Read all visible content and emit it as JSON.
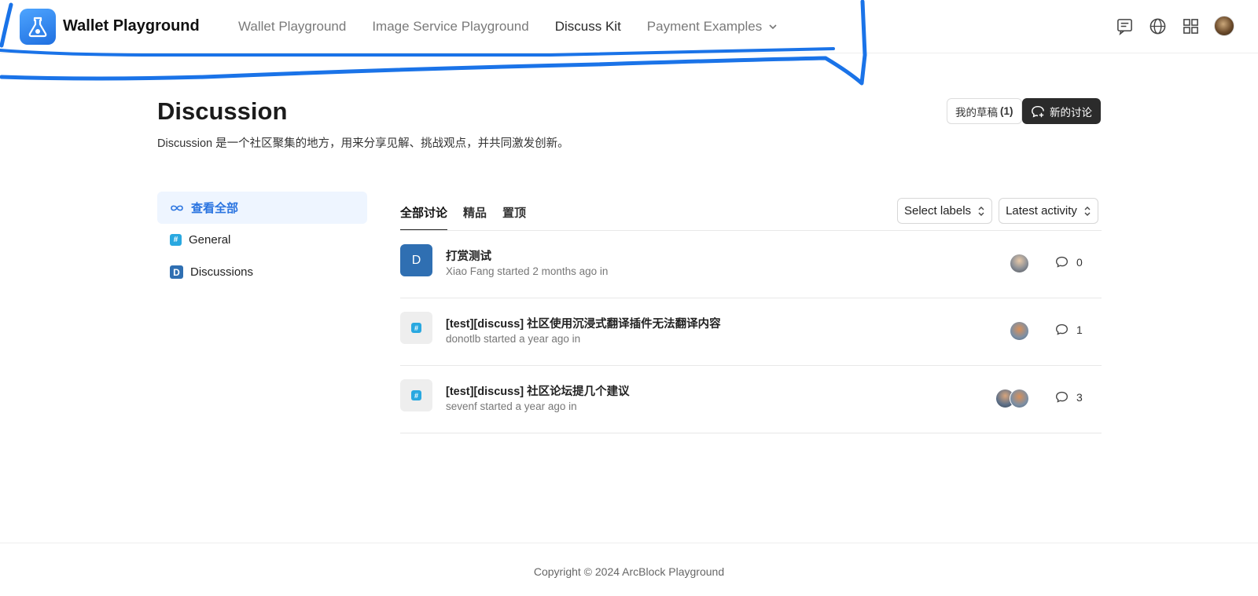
{
  "header": {
    "brand": "Wallet Playground",
    "nav": [
      {
        "label": "Wallet Playground"
      },
      {
        "label": "Image Service Playground"
      },
      {
        "label": "Discuss Kit"
      },
      {
        "label": "Payment Examples"
      }
    ],
    "icons": [
      "chat-icon",
      "globe-icon",
      "apps-grid-icon",
      "user-avatar"
    ]
  },
  "page": {
    "title": "Discussion",
    "description": "Discussion 是一个社区聚集的地方，用来分享见解、挑战观点，并共同激发创新。",
    "drafts_label": "我的草稿",
    "drafts_count": "(1)",
    "new_button": "新的讨论"
  },
  "sidebar": {
    "items": [
      {
        "label": "查看全部",
        "icon": "infinity-icon"
      },
      {
        "label": "General",
        "icon": "hash-icon"
      },
      {
        "label": "Discussions",
        "icon": "d-icon"
      }
    ]
  },
  "tabs": [
    {
      "label": "全部讨论"
    },
    {
      "label": "精品"
    },
    {
      "label": "置顶"
    }
  ],
  "filters": {
    "labels_select": "Select labels",
    "sort_select": "Latest activity"
  },
  "discussions": [
    {
      "icon_letter": "D",
      "title": "打赏测试",
      "meta": "Xiao Fang started 2 months ago in",
      "comments": "0"
    },
    {
      "icon_letter": "",
      "title": "[test][discuss] 社区使用沉浸式翻译插件无法翻译内容",
      "meta": "donotlb started a year ago in",
      "comments": "1"
    },
    {
      "icon_letter": "",
      "title": "[test][discuss] 社区论坛提几个建议",
      "meta": "sevenf started a year ago in",
      "comments": "3"
    }
  ],
  "footer": {
    "copyright": "Copyright © 2024 ArcBlock Playground"
  },
  "colors": {
    "accent": "#2a74e0",
    "dark_button": "#2b2b2b",
    "scribble": "#1a73e8"
  }
}
